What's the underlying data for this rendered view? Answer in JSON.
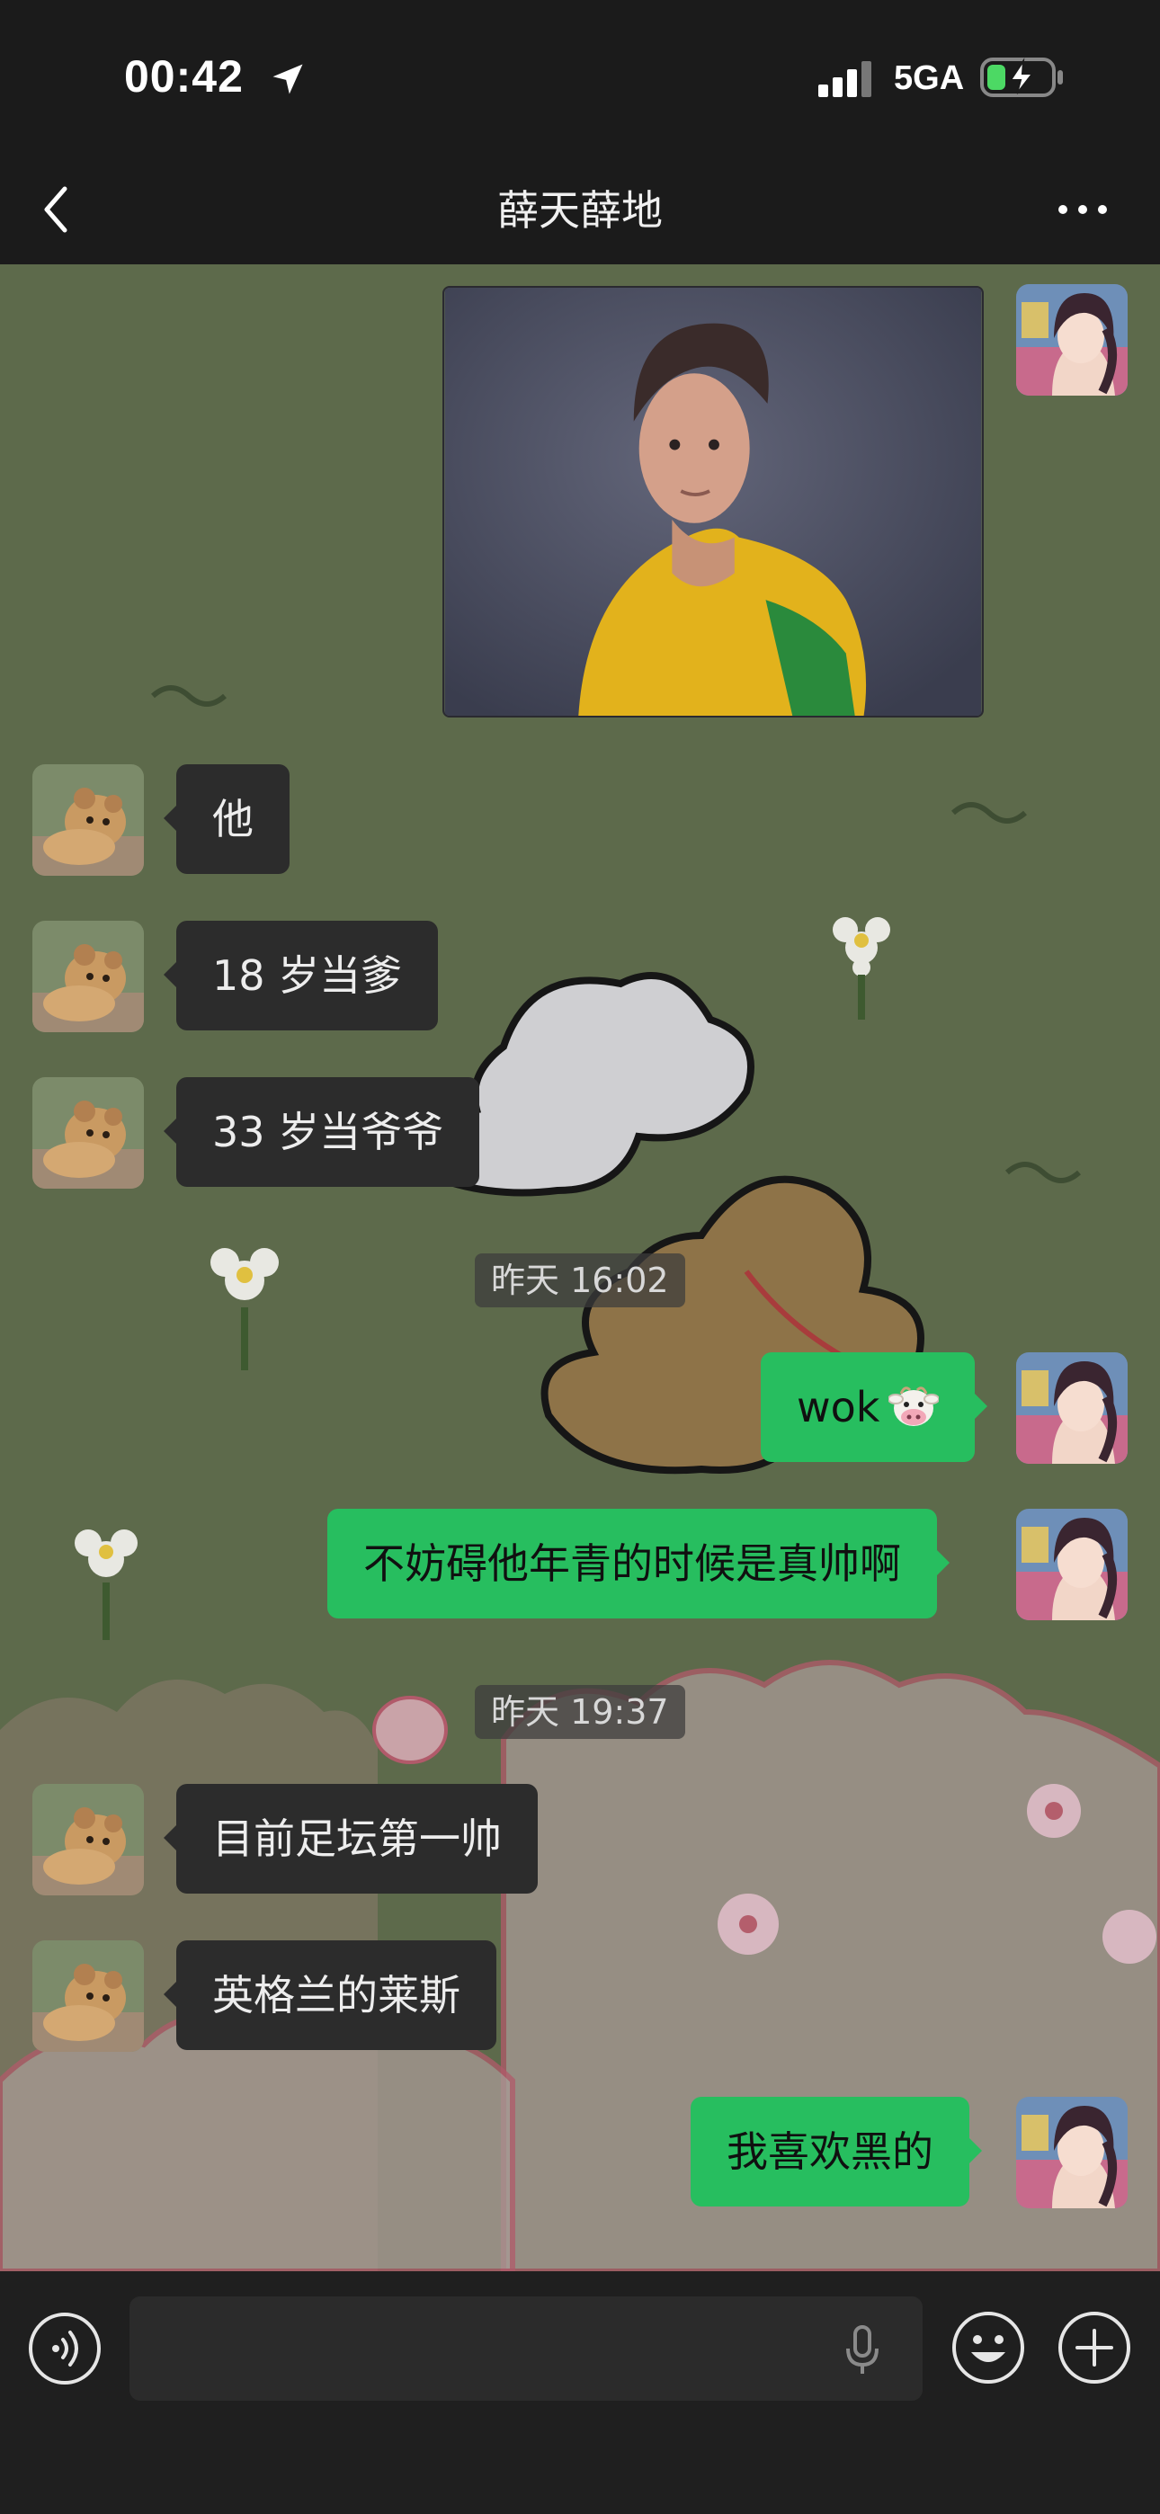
{
  "status_bar": {
    "time": "00:42",
    "network": "5GA",
    "icons": [
      "location-arrow-icon",
      "signal-icon",
      "battery-charging-icon"
    ]
  },
  "nav": {
    "title": "薛天薛地",
    "back_icon": "chevron-left-icon",
    "more_icon": "more-dots-icon"
  },
  "messages": [
    {
      "side": "out",
      "kind": "image",
      "description": "photo"
    },
    {
      "side": "in",
      "text": "他"
    },
    {
      "side": "in",
      "text": "18 岁当爹"
    },
    {
      "side": "in",
      "text": "33 岁当爷爷"
    },
    {
      "kind": "time",
      "text": "昨天 16:02"
    },
    {
      "side": "out",
      "text": "wok",
      "emoji": "cow-face-icon"
    },
    {
      "side": "out",
      "text": "不妨碍他年青的时候是真帅啊"
    },
    {
      "kind": "time",
      "text": "昨天 19:37"
    },
    {
      "side": "in",
      "text": "目前足坛第一帅"
    },
    {
      "side": "in",
      "text": "英格兰的莱斯"
    },
    {
      "side": "out",
      "text": "我喜欢黑的"
    }
  ],
  "input_bar": {
    "placeholder": "",
    "icons": [
      "voice-icon",
      "microphone-icon",
      "emoji-icon",
      "plus-icon"
    ]
  },
  "colors": {
    "outgoing_bubble": "#27be5f",
    "incoming_bubble": "#2c2c2c",
    "chat_background": "#5d6a4b",
    "bar_background": "#1b1b1b"
  }
}
